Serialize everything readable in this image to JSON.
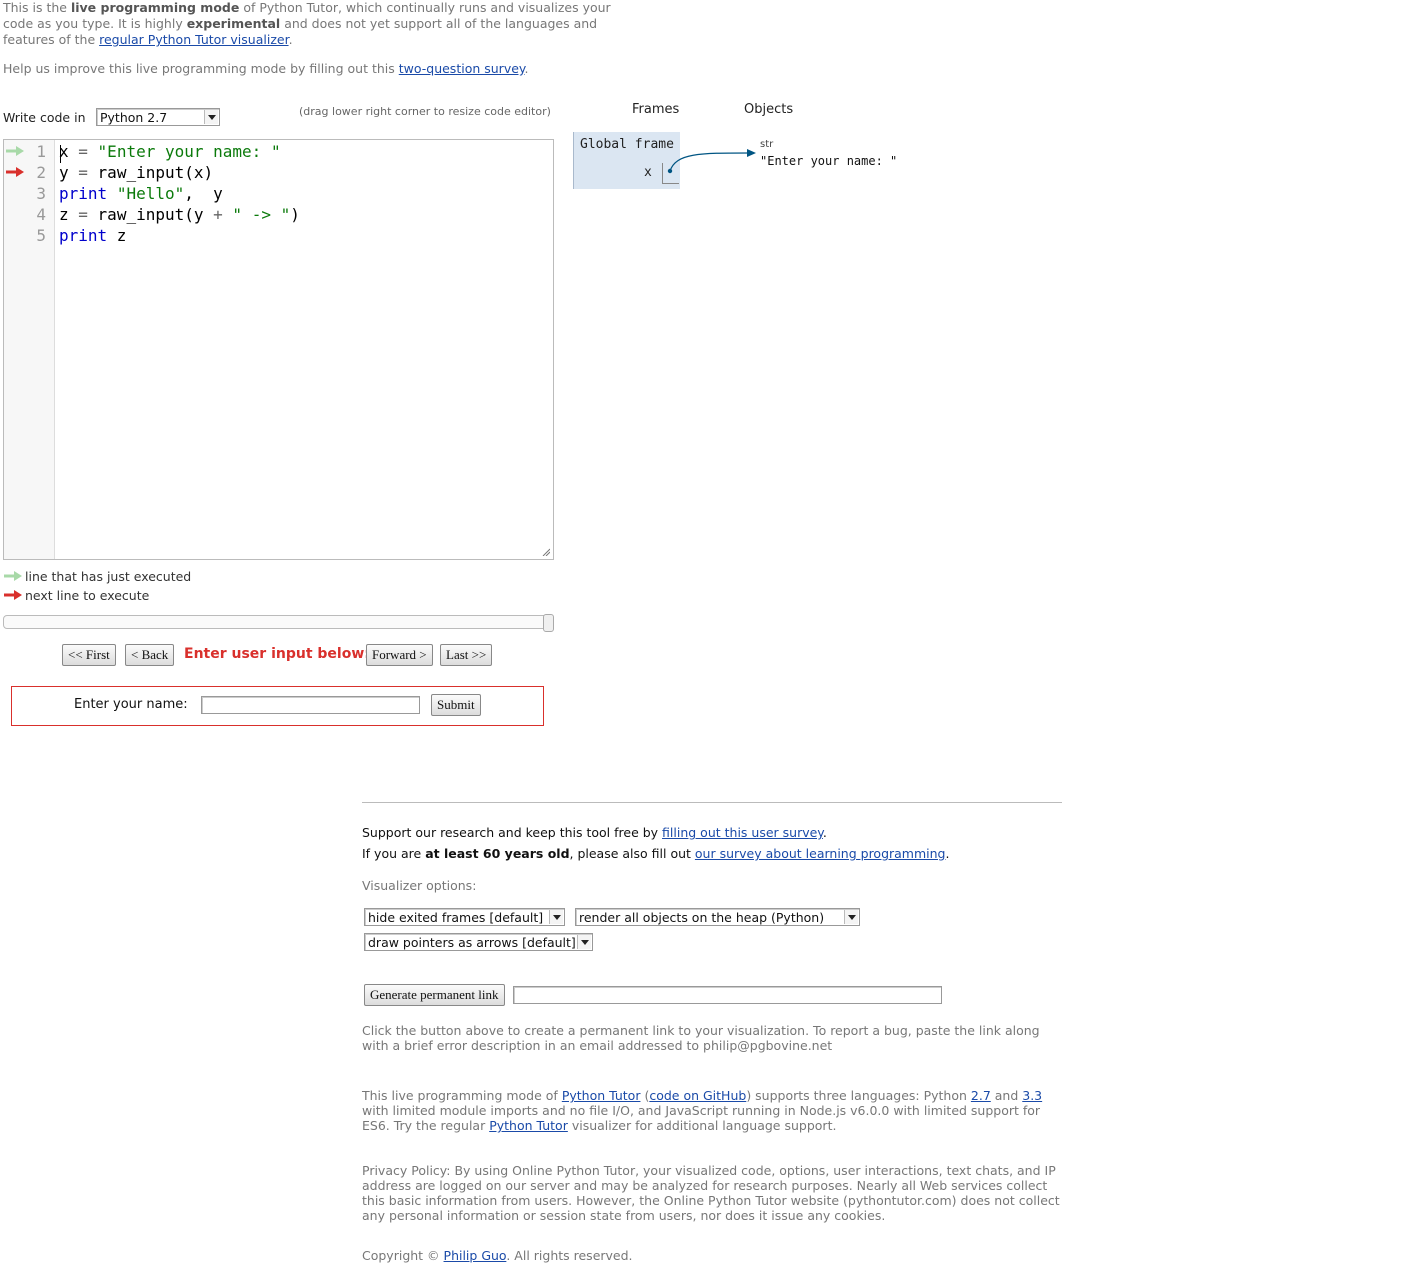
{
  "intro": {
    "p1": "This is the ",
    "live_mode": "live programming mode",
    "p2": " of Python Tutor, which continually runs and visualizes your code as you type. It is highly ",
    "experimental": "experimental",
    "p3": " and does not yet support all of the languages and features of the ",
    "regular_link": "regular Python Tutor visualizer",
    "p4": ".",
    "help_pre": "Help us improve this live programming mode by filling out this ",
    "survey_link": "two-question survey",
    "help_post": "."
  },
  "editor": {
    "write_label": "Write code in",
    "language": "Python 2.7",
    "drag_hint": "(drag lower right corner to resize code editor)",
    "line_numbers": [
      "1",
      "2",
      "3",
      "4",
      "5"
    ]
  },
  "legend": {
    "executed": "line that has just executed",
    "next": "next line to execute",
    "green": "#a8d9a8",
    "red": "#d9302c"
  },
  "nav": {
    "first": "<< First",
    "back": "< Back",
    "prompt": "Enter user input below:",
    "forward": "Forward >",
    "last": "Last >>"
  },
  "user_input": {
    "label": "Enter your name:",
    "value": "",
    "submit": "Submit"
  },
  "viz": {
    "frames_header": "Frames",
    "objects_header": "Objects",
    "frame_name": "Global frame",
    "var_name": "x",
    "obj_type": "str",
    "obj_value": "\"Enter your name: \""
  },
  "footer": {
    "support_pre": "Support our research and keep this tool free by ",
    "support_link": "filling out this user survey",
    "support_post": ".",
    "age_pre": "If you are ",
    "age_bold": "at least 60 years old",
    "age_mid": ", please also fill out ",
    "age_link": "our survey about learning programming",
    "age_post": ".",
    "viz_options": "Visualizer options:",
    "opt_frames": "hide exited frames [default]",
    "opt_heap": "render all objects on the heap (Python)",
    "opt_pointers": "draw pointers as arrows [default]",
    "permalink_btn": "Generate permanent link",
    "permalink_value": "",
    "bug_text": "Click the button above to create a permanent link to your visualization. To report a bug, paste the link along with a brief error description in an email addressed to philip@pgbovine.net",
    "lang_p1": "This live programming mode of ",
    "lang_link1": "Python Tutor",
    "lang_p2": " (",
    "lang_link2": "code on GitHub",
    "lang_p3": ") supports three languages: Python ",
    "lang_link3": "2.7",
    "lang_p4": " and ",
    "lang_link4": "3.3",
    "lang_p5": " with limited module imports and no file I/O, and JavaScript running in Node.js v6.0.0 with limited support for ES6. Try the regular ",
    "lang_link5": "Python Tutor",
    "lang_p6": " visualizer for additional language support.",
    "privacy": "Privacy Policy: By using Online Python Tutor, your visualized code, options, user interactions, text chats, and IP address are logged on our server and may be analyzed for research purposes. Nearly all Web services collect this basic information from users. However, the Online Python Tutor website (pythontutor.com) does not collect any personal information or session state from users, nor does it issue any cookies.",
    "copy_pre": "Copyright © ",
    "copy_link": "Philip Guo",
    "copy_post": ". All rights reserved."
  },
  "code": {
    "l1_var": "x",
    "l1_eq": " = ",
    "l1_str": "\"Enter your name: \"",
    "l2_var": "y",
    "l2_eq": " = ",
    "l2_rest": "raw_input(x)",
    "l3_kw": "print",
    "l3_sp": " ",
    "l3_str": "\"Hello\"",
    "l3_rest": ",  y",
    "l4_var": "z",
    "l4_eq": " = ",
    "l4_fn": "raw_input(y ",
    "l4_plus": "+",
    "l4_sp": " ",
    "l4_str": "\" -> \"",
    "l4_close": ")",
    "l5_kw": "print",
    "l5_rest": " z"
  }
}
